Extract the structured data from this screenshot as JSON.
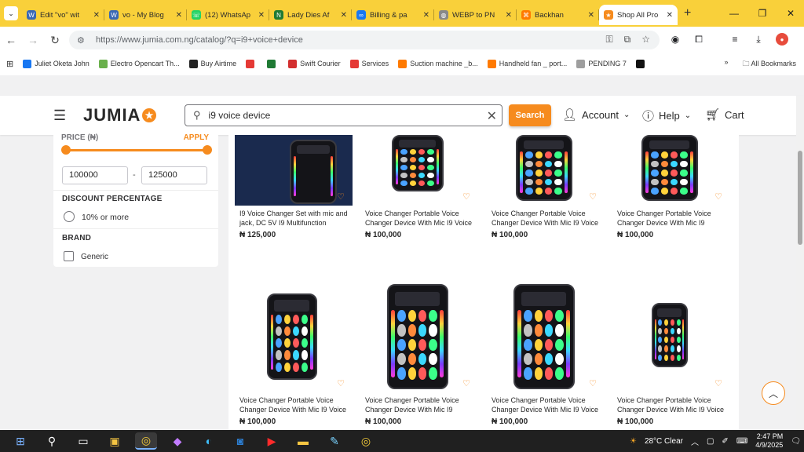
{
  "browser": {
    "tabs": [
      {
        "title": "Edit \"vo\" wit",
        "fav_color": "#3a68b4",
        "fav_glyph": "W"
      },
      {
        "title": "vo - My Blog",
        "fav_color": "#3a68b4",
        "fav_glyph": "W"
      },
      {
        "title": "(12) WhatsAp",
        "fav_color": "#25d366",
        "fav_glyph": "☏"
      },
      {
        "title": "Lady Dies Af",
        "fav_color": "#1f7a34",
        "fav_glyph": "N"
      },
      {
        "title": "Billing & pa",
        "fav_color": "#1877f2",
        "fav_glyph": "∞"
      },
      {
        "title": "WEBP to PN",
        "fav_color": "#888888",
        "fav_glyph": "◍"
      },
      {
        "title": "Backhan",
        "fav_color": "#ff7a00",
        "fav_glyph": "⌘"
      },
      {
        "title": "Shop All Pro",
        "fav_color": "#f68b1e",
        "fav_glyph": "★"
      }
    ],
    "active_tab_index": 7,
    "url": "https://www.jumia.com.ng/catalog/?q=i9+voice+device",
    "bookmarks": [
      {
        "label": "Juliet Oketa John",
        "color": "#1877f2"
      },
      {
        "label": "Electro Opencart Th...",
        "color": "#6ab04c"
      },
      {
        "label": "Buy Airtime",
        "color": "#222222"
      },
      {
        "label": "",
        "color": "#e53935"
      },
      {
        "label": "",
        "color": "#1f7a34"
      },
      {
        "label": "Swift Courier",
        "color": "#d32f2f"
      },
      {
        "label": "Services",
        "color": "#e53935"
      },
      {
        "label": "Suction machine _b...",
        "color": "#ff7a00"
      },
      {
        "label": "Handheld fan _ port...",
        "color": "#ff7a00"
      },
      {
        "label": "PENDING 7",
        "color": "#9e9e9e"
      },
      {
        "label": "",
        "color": "#111111"
      }
    ],
    "all_bookmarks_label": "All Bookmarks"
  },
  "header": {
    "logo": "JUMIA",
    "search_value": "i9 voice device",
    "search_button": "Search",
    "account": "Account",
    "help": "Help",
    "cart": "Cart"
  },
  "filters": {
    "price_heading": "PRICE (₦)",
    "apply": "APPLY",
    "min": "100000",
    "max": "125000",
    "discount_heading": "DISCOUNT PERCENTAGE",
    "discount_option": "10% or more",
    "brand_heading": "BRAND",
    "brand_option": "Generic"
  },
  "products": [
    {
      "name": "I9 Voice Changer Set with mic and jack, DC 5V I9 Multifunction Voicc...",
      "price": "₦ 125,000"
    },
    {
      "name": "Voice Changer Portable Voice Changer Device With Mic I9 Voice",
      "price": "₦ 100,000"
    },
    {
      "name": "Voice Changer Portable Voice Changer Device With Mic I9 Voice",
      "price": "₦ 100,000"
    },
    {
      "name": "Voice Changer Portable Voice Changer Device With Mic I9 Voice...",
      "price": "₦ 100,000"
    },
    {
      "name": "Voice Changer Portable Voice Changer Device With Mic I9 Voice",
      "price": "₦ 100,000"
    },
    {
      "name": "Voice Changer Portable Voice Changer Device With Mic I9",
      "price": "₦ 100,000"
    },
    {
      "name": "Voice Changer Portable Voice Changer Device With Mic I9 Voice",
      "price": "₦ 100,000"
    },
    {
      "name": "Voice Changer Portable Voice Changer Device With Mic I9 Voice",
      "price": "₦ 100,000"
    }
  ],
  "taskbar": {
    "weather": "28°C Clear",
    "time": "2:47 PM",
    "date": "4/9/2025"
  },
  "colors": {
    "accent": "#f68b1e",
    "tabstrip": "#f9d03a"
  }
}
